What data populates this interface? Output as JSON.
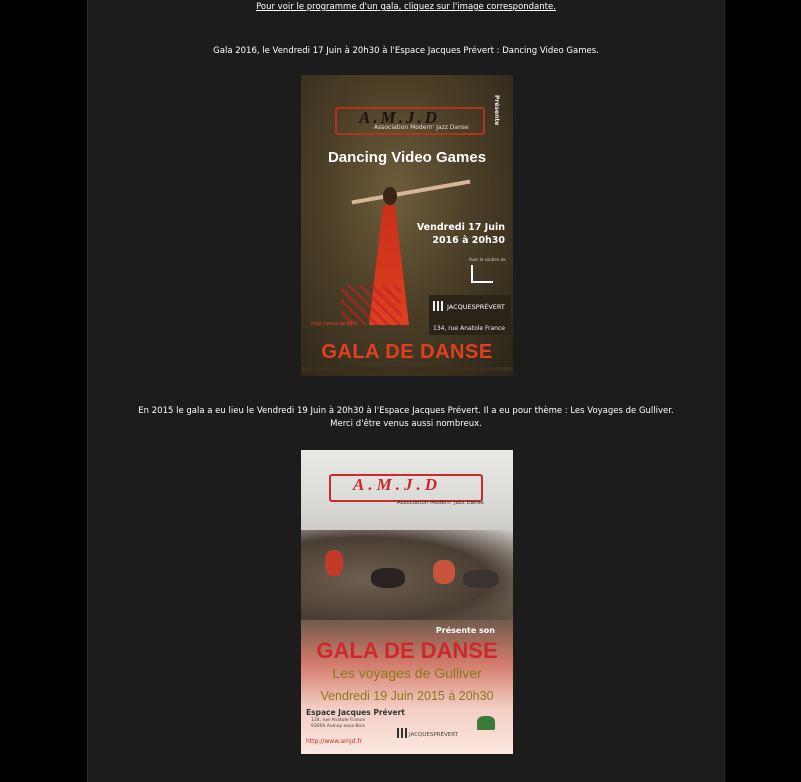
{
  "intro": {
    "link_text": "Pour voir le programme d'un gala, cliquez sur l'image correspondante."
  },
  "galas": [
    {
      "caption": "Gala 2016, le Vendredi 17 Juin à 20h30 à l'Espace Jacques Prévert : Dancing Video Games.",
      "poster": {
        "logo": "A.M.J.D",
        "association": "Association Modern' Jazz Danse",
        "presente": "Présente",
        "title": "Dancing Video Games",
        "date_line1": "Vendredi 17 Juin",
        "date_line2": "2016 à 20h30",
        "sponsor_label": "Avec le soutien de",
        "venue_name": "JACQUESPRÉVERT",
        "venue_address": "134, rue Anatole France",
        "url": "http://www.amjd.fr",
        "footer": "GALA DE DANSE"
      }
    },
    {
      "caption_line1": "En 2015 le gala a eu lieu le Vendredi 19 Juin à 20h30 à l'Espace Jacques Prévert. Il a eu pour thème : Les Voyages de Gulliver.",
      "caption_line2": "Merci d'être venus aussi nombreux.",
      "poster": {
        "logo": "A.M.J.D",
        "association": "Association Modern' Jazz Danse",
        "presente": "Présente son",
        "title": "GALA DE DANSE",
        "theme": "Les voyages de Gulliver",
        "date": "Vendredi 19 Juin 2015 à 20h30",
        "venue_name": "Espace Jacques Prévert",
        "venue_address_1": "134, rue Anatole France",
        "venue_address_2": "93600 Aulnay-sous-Bois",
        "url": "http://www.amjd.fr",
        "jp_name": "JACQUESPRÉVERT"
      }
    }
  ],
  "colors": {
    "page_background": "#000000",
    "content_background": "#1c1c1c",
    "text": "#ffffff",
    "accent_red": "#e04020"
  }
}
